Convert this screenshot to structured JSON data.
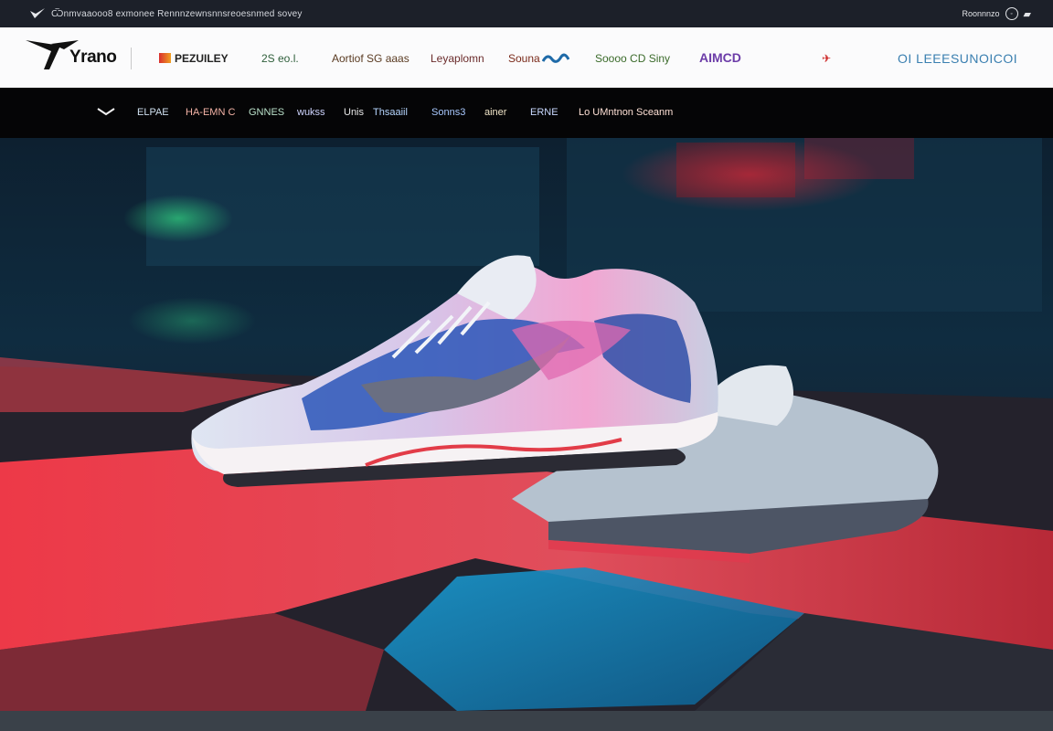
{
  "topbar": {
    "ticker": "Ѿnmvaaooo8 exmonee Rennnzewnsnnsreoesnmed sovey",
    "account": "Roonnnzo",
    "globe_icon": "globe-icon",
    "bag_icon": "bag-icon"
  },
  "brand": {
    "logo_text": "Yrano"
  },
  "partners": [
    "PEZUILEY",
    "2S eo.l.",
    "Aortiof SG aaas",
    "Leyaplomn",
    "Souna",
    "Soooo CD Siny",
    "AIMCD",
    "✈",
    "OI LEEESUNOICOI"
  ],
  "nav": {
    "menu_icon": "chevron-down-icon",
    "items": [
      "ELPAE",
      "HA-EMN C",
      "GNNES",
      "wukss",
      "Unis",
      "Thsaaiil",
      "Sonns3",
      "ainer",
      "ERNE",
      "Lo UMntnon Sceanm"
    ]
  },
  "colors": {
    "nav_bg": "#050506",
    "brand_bg": "#fbfbfc",
    "accent_red": "#e23c48",
    "accent_blue": "#2a4fa8"
  }
}
